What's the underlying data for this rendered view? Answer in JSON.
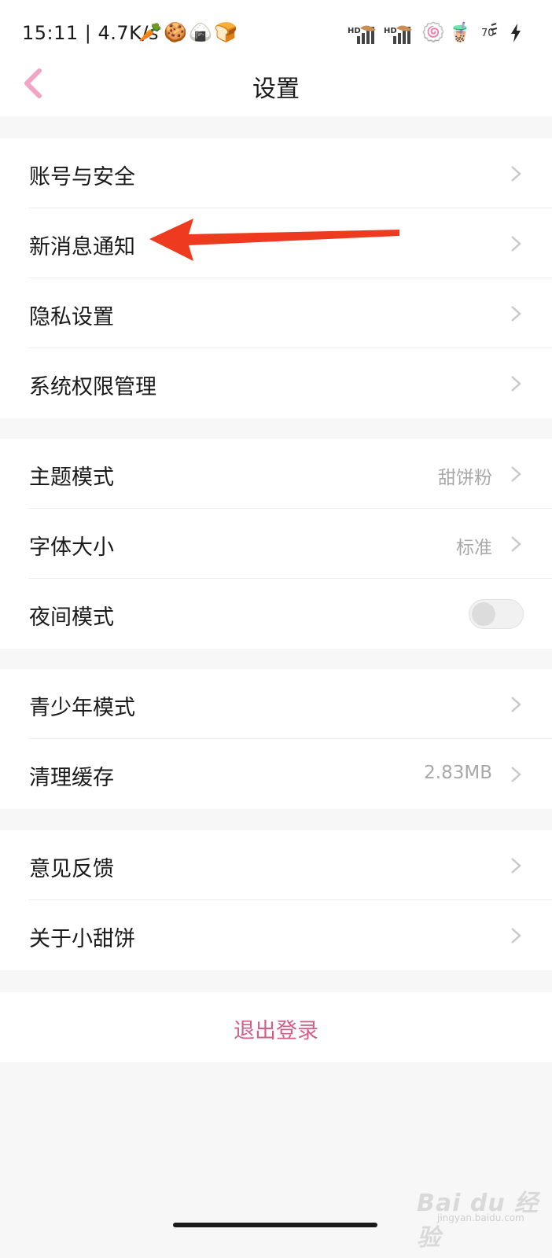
{
  "status_bar": {
    "time": "15:11 | 4.7K/s",
    "battery": "70",
    "hd_label": "HD",
    "emoji_left": [
      "🥕",
      "🍪",
      "🍙",
      "🍞"
    ],
    "emoji_right": [
      "🍥",
      "🧋"
    ]
  },
  "nav": {
    "title": "设置",
    "back_icon": "chevron-left-icon",
    "accent_color": "#f2a4c4"
  },
  "groups": [
    {
      "items": [
        {
          "label": "账号与安全",
          "value": ""
        },
        {
          "label": "新消息通知",
          "value": ""
        },
        {
          "label": "隐私设置",
          "value": ""
        },
        {
          "label": "系统权限管理",
          "value": ""
        }
      ]
    },
    {
      "items": [
        {
          "label": "主题模式",
          "value": "甜饼粉"
        },
        {
          "label": "字体大小",
          "value": "标准"
        },
        {
          "label": "夜间模式",
          "toggle": false
        }
      ]
    },
    {
      "items": [
        {
          "label": "青少年模式",
          "value": ""
        },
        {
          "label": "清理缓存",
          "value": "2.83MB"
        }
      ]
    },
    {
      "items": [
        {
          "label": "意见反馈",
          "value": ""
        },
        {
          "label": "关于小甜饼",
          "value": ""
        }
      ]
    }
  ],
  "logout": {
    "label": "退出登录",
    "color": "#d0608a"
  },
  "annotation": {
    "arrow_color": "#ee3a1f"
  },
  "watermark": {
    "text": "Bai du 经验",
    "sub": "jingyan.baidu.com"
  }
}
